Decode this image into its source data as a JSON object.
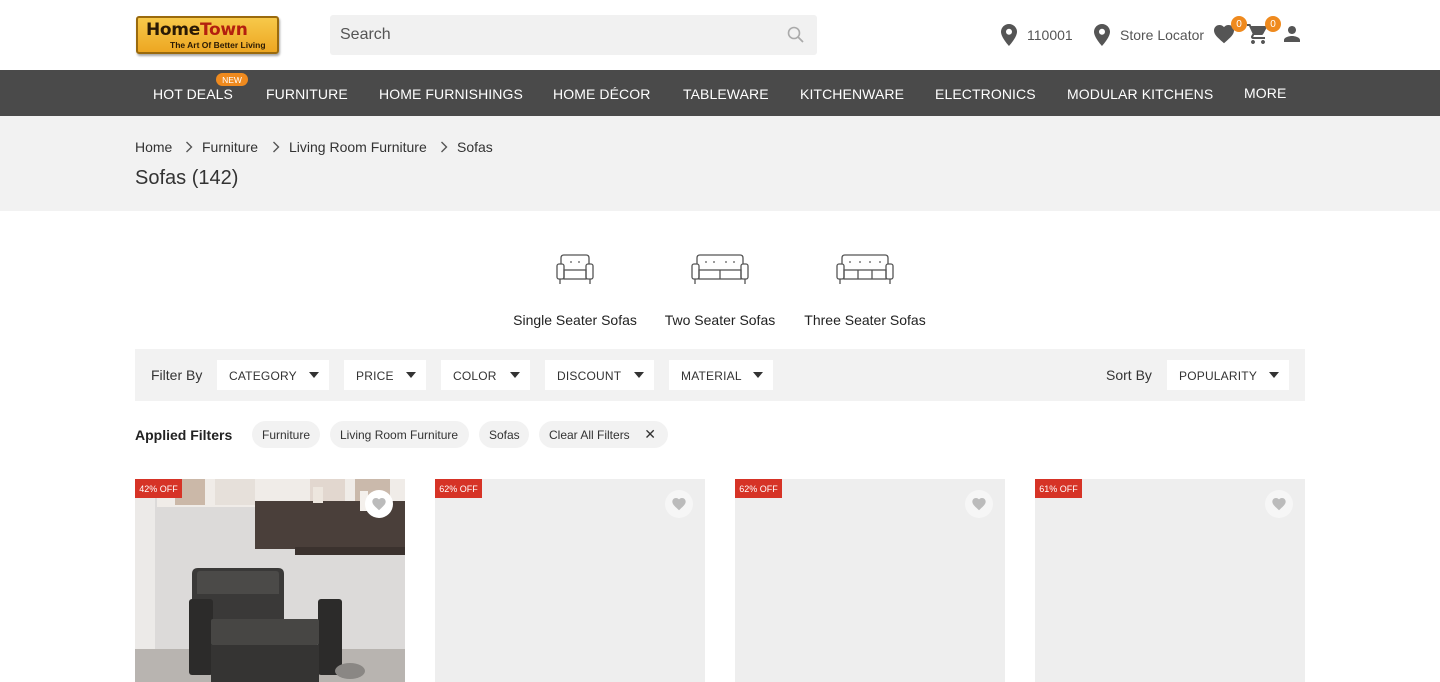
{
  "brand": {
    "logo_main_a": "Home",
    "logo_main_b": "Town",
    "logo_tagline": "The Art Of Better Living"
  },
  "search": {
    "placeholder": "Search",
    "value": ""
  },
  "header": {
    "pincode": "110001",
    "store_locator": "Store Locator",
    "wishlist_count": "0",
    "cart_count": "0"
  },
  "nav": {
    "items": [
      {
        "label": "HOT DEALS",
        "badge": "NEW"
      },
      {
        "label": "FURNITURE"
      },
      {
        "label": "HOME FURNISHINGS"
      },
      {
        "label": "HOME DÉCOR"
      },
      {
        "label": "TABLEWARE"
      },
      {
        "label": "KITCHENWARE"
      },
      {
        "label": "ELECTRONICS"
      },
      {
        "label": "MODULAR KITCHENS"
      },
      {
        "label": "MORE"
      }
    ]
  },
  "breadcrumb": [
    "Home",
    "Furniture",
    "Living Room Furniture",
    "Sofas"
  ],
  "page_title": "Sofas (142)",
  "categories": [
    {
      "label": "Single Seater Sofas",
      "icon": "single-seater-sofa-icon"
    },
    {
      "label": "Two Seater Sofas",
      "icon": "two-seater-sofa-icon"
    },
    {
      "label": "Three Seater Sofas",
      "icon": "three-seater-sofa-icon"
    }
  ],
  "filters": {
    "filter_by_label": "Filter By",
    "dropdowns": [
      "CATEGORY",
      "PRICE",
      "COLOR",
      "DISCOUNT",
      "MATERIAL"
    ],
    "sort_by_label": "Sort By",
    "sort_value": "POPULARITY"
  },
  "applied_filters": {
    "label": "Applied Filters",
    "chips": [
      "Furniture",
      "Living Room Furniture",
      "Sofas"
    ],
    "clear_label": "Clear All Filters"
  },
  "products": [
    {
      "discount": "42% OFF"
    },
    {
      "discount": "62% OFF"
    },
    {
      "discount": "62% OFF"
    },
    {
      "discount": "61% OFF"
    }
  ],
  "colors": {
    "nav_bg": "#4a4a4a",
    "badge_orange": "#ef8a1e",
    "discount_red": "#d63326",
    "band_gray": "#f2f2f2"
  }
}
